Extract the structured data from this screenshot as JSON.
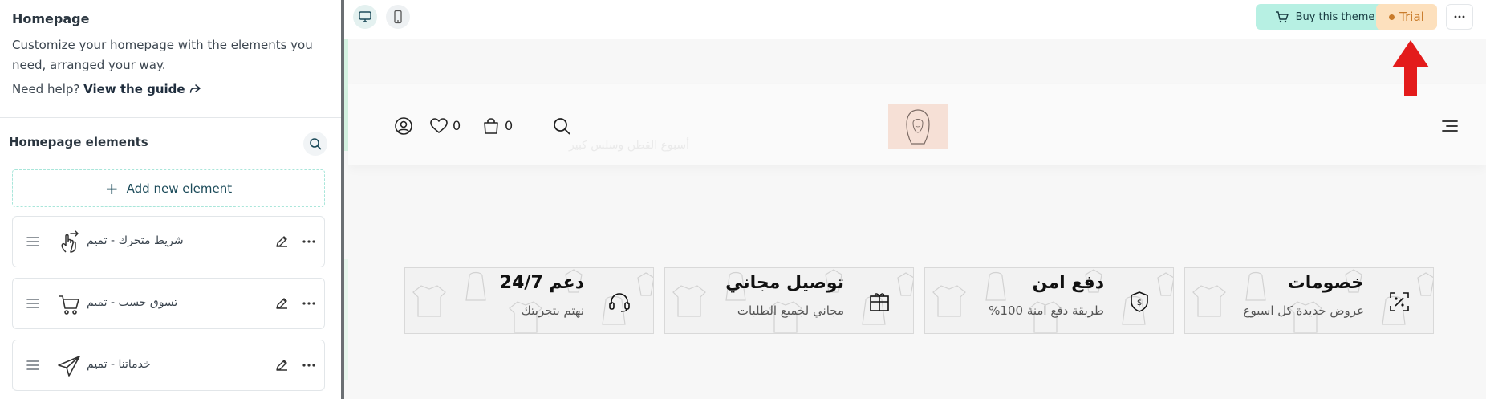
{
  "sidebar": {
    "title": "Homepage",
    "description": "Customize your homepage with the elements you need, arranged your way.",
    "help_prefix": "Need help?",
    "help_link": "View the guide",
    "elements_title": "Homepage elements",
    "add_label": "Add new element",
    "elements": [
      {
        "label": "شريط متحرك - تميم",
        "icon": "swipe-hand-icon"
      },
      {
        "label": "تسوق حسب - تميم",
        "icon": "shopping-cart-icon"
      },
      {
        "label": "خدماتنا - تميم",
        "icon": "paper-plane-icon"
      }
    ]
  },
  "topbar": {
    "buy_label": "Buy this theme",
    "trial_label": "Trial"
  },
  "store": {
    "wishlist_count": "0",
    "cart_count": "0",
    "faded_text": "أسبوع القطن وسلس كبير"
  },
  "features": [
    {
      "title": "خصومات",
      "subtitle": "عروض جديدة كل اسبوع",
      "icon": "discount-icon"
    },
    {
      "title": "دفع امن",
      "subtitle": "طريقة دفع امنة 100%",
      "icon": "secure-shield-icon"
    },
    {
      "title": "توصيل مجاني",
      "subtitle": "مجاني لجميع الطلبات",
      "icon": "gift-box-icon"
    },
    {
      "title": "دعم 24/7",
      "subtitle": "نهتم بتجربتك",
      "icon": "headset-icon"
    }
  ],
  "colors": {
    "accent_mint": "#b7f0e3",
    "trial_orange": "#fde0bd",
    "arrow_red": "#e31b1b"
  }
}
